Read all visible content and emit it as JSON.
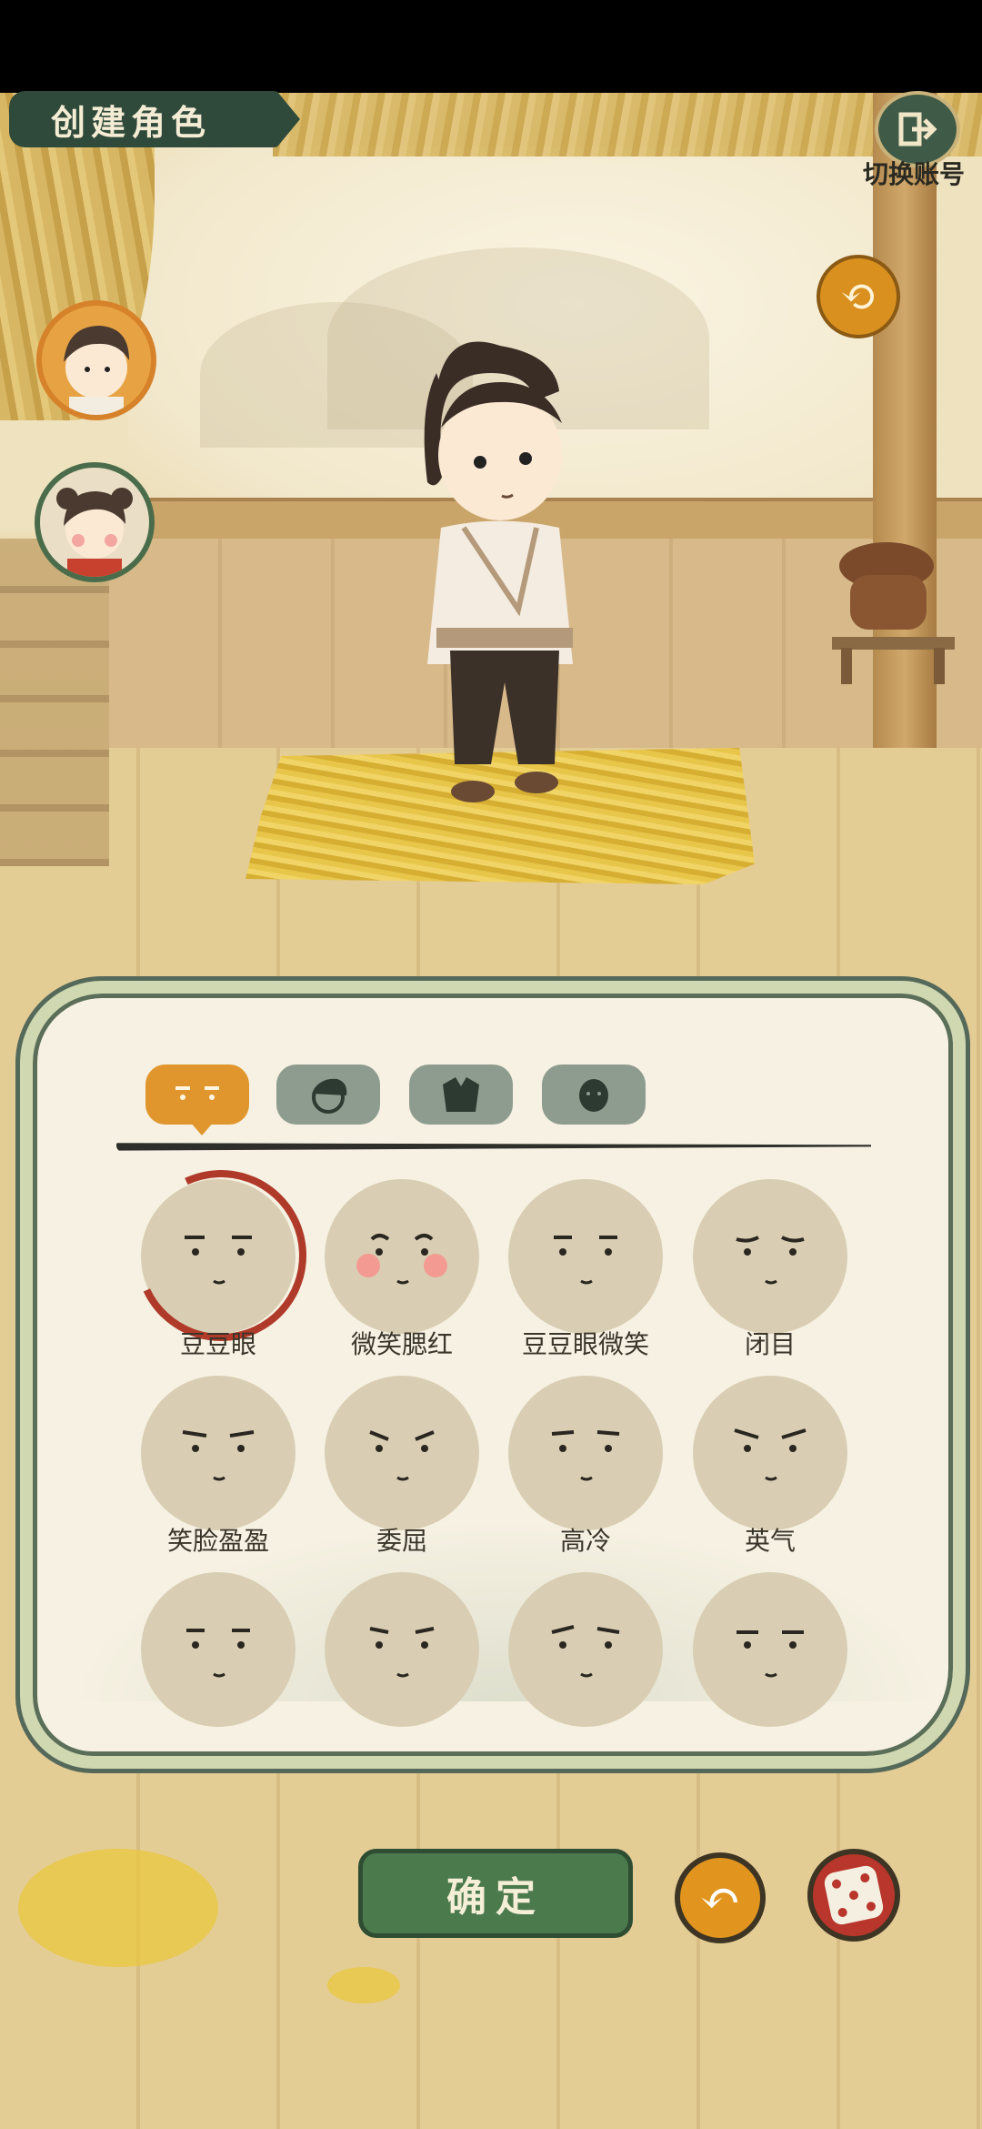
{
  "header": {
    "title": "创建角色",
    "switch_account_label": "切换账号"
  },
  "tabs": [
    {
      "name": "face",
      "icon": "face-icon",
      "active": true
    },
    {
      "name": "hair",
      "icon": "hair-icon",
      "active": false
    },
    {
      "name": "clothes",
      "icon": "clothes-icon",
      "active": false
    },
    {
      "name": "skin",
      "icon": "skin-icon",
      "active": false
    }
  ],
  "faces": [
    {
      "label": "豆豆眼",
      "selected": true
    },
    {
      "label": "微笑腮红",
      "selected": false
    },
    {
      "label": "豆豆眼微笑",
      "selected": false
    },
    {
      "label": "闭目",
      "selected": false
    },
    {
      "label": "笑脸盈盈",
      "selected": false
    },
    {
      "label": "委屈",
      "selected": false
    },
    {
      "label": "高冷",
      "selected": false
    },
    {
      "label": "英气",
      "selected": false
    },
    {
      "label": "",
      "selected": false
    },
    {
      "label": "",
      "selected": false
    },
    {
      "label": "",
      "selected": false
    },
    {
      "label": "",
      "selected": false
    }
  ],
  "actions": {
    "confirm_label": "确定"
  },
  "colors": {
    "accent": "#e0962c",
    "confirm": "#4b7a4d",
    "selected_ring": "#b03a2a"
  }
}
